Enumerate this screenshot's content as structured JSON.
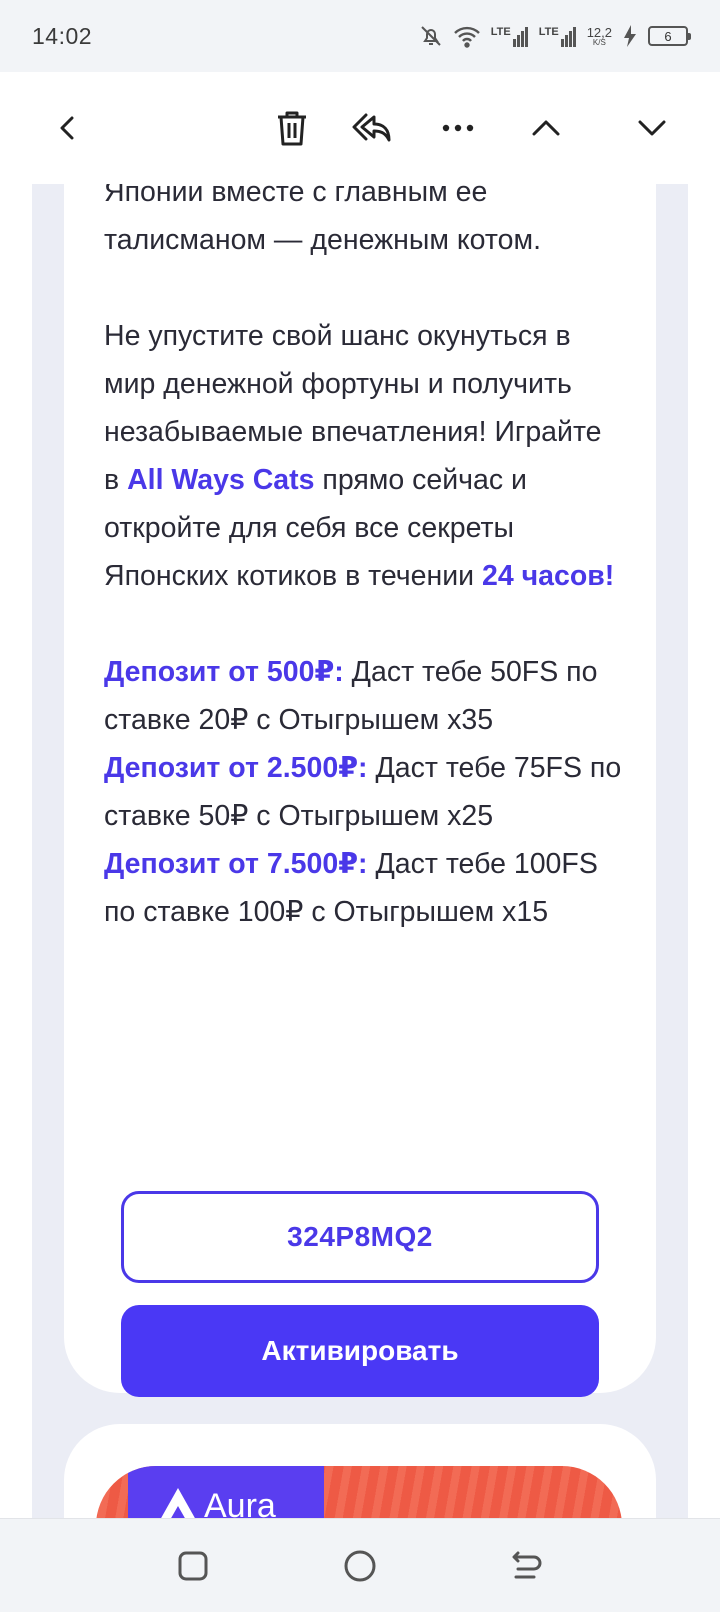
{
  "status_bar": {
    "time": "14:02",
    "network_1": "LTE",
    "network_2": "LTE",
    "speed_value": "12,2",
    "speed_unit": "K/S",
    "battery_level": "6"
  },
  "toolbar": {
    "icons": [
      "back-icon",
      "trash-icon",
      "reply-all-icon",
      "more-icon",
      "chevron-up-icon",
      "chevron-down-icon"
    ]
  },
  "message": {
    "partial_line_top": "Японии вместе с главным ее",
    "para1_line": "талисманом — денежным котом.",
    "para2_text1": "Не упустите свой шанс окунуться в мир денежной фортуны и получить незабываемые впечатления! Играйте в ",
    "para2_hl1": "All Ways Cats",
    "para2_text2": " прямо сейчас и откройте для себя все секреты Японских котиков в течении ",
    "para2_hl2": "24 часов!",
    "deposits": [
      {
        "label": "Депозит от 500₽:",
        "text": " Даст тебе 50FS по ставке 20₽ с Отыгрышем х35"
      },
      {
        "label": "Депозит от 2.500₽:",
        "text": " Даст тебе 75FS по ставке 50₽ с Отыгрышем х25"
      },
      {
        "label": "Депозит от 7.500₽:",
        "text": " Даст тебе 100FS по ставке 100₽ с Отыгрышем х15"
      }
    ],
    "promo_code": "324P8MQ2",
    "activate_label": "Активировать"
  },
  "banner": {
    "brand": "Aura"
  },
  "colors": {
    "accent": "#4a38e8",
    "button": "#4a38f5",
    "page_bg": "#ebedf5",
    "banner_red": "#ee5a45"
  }
}
